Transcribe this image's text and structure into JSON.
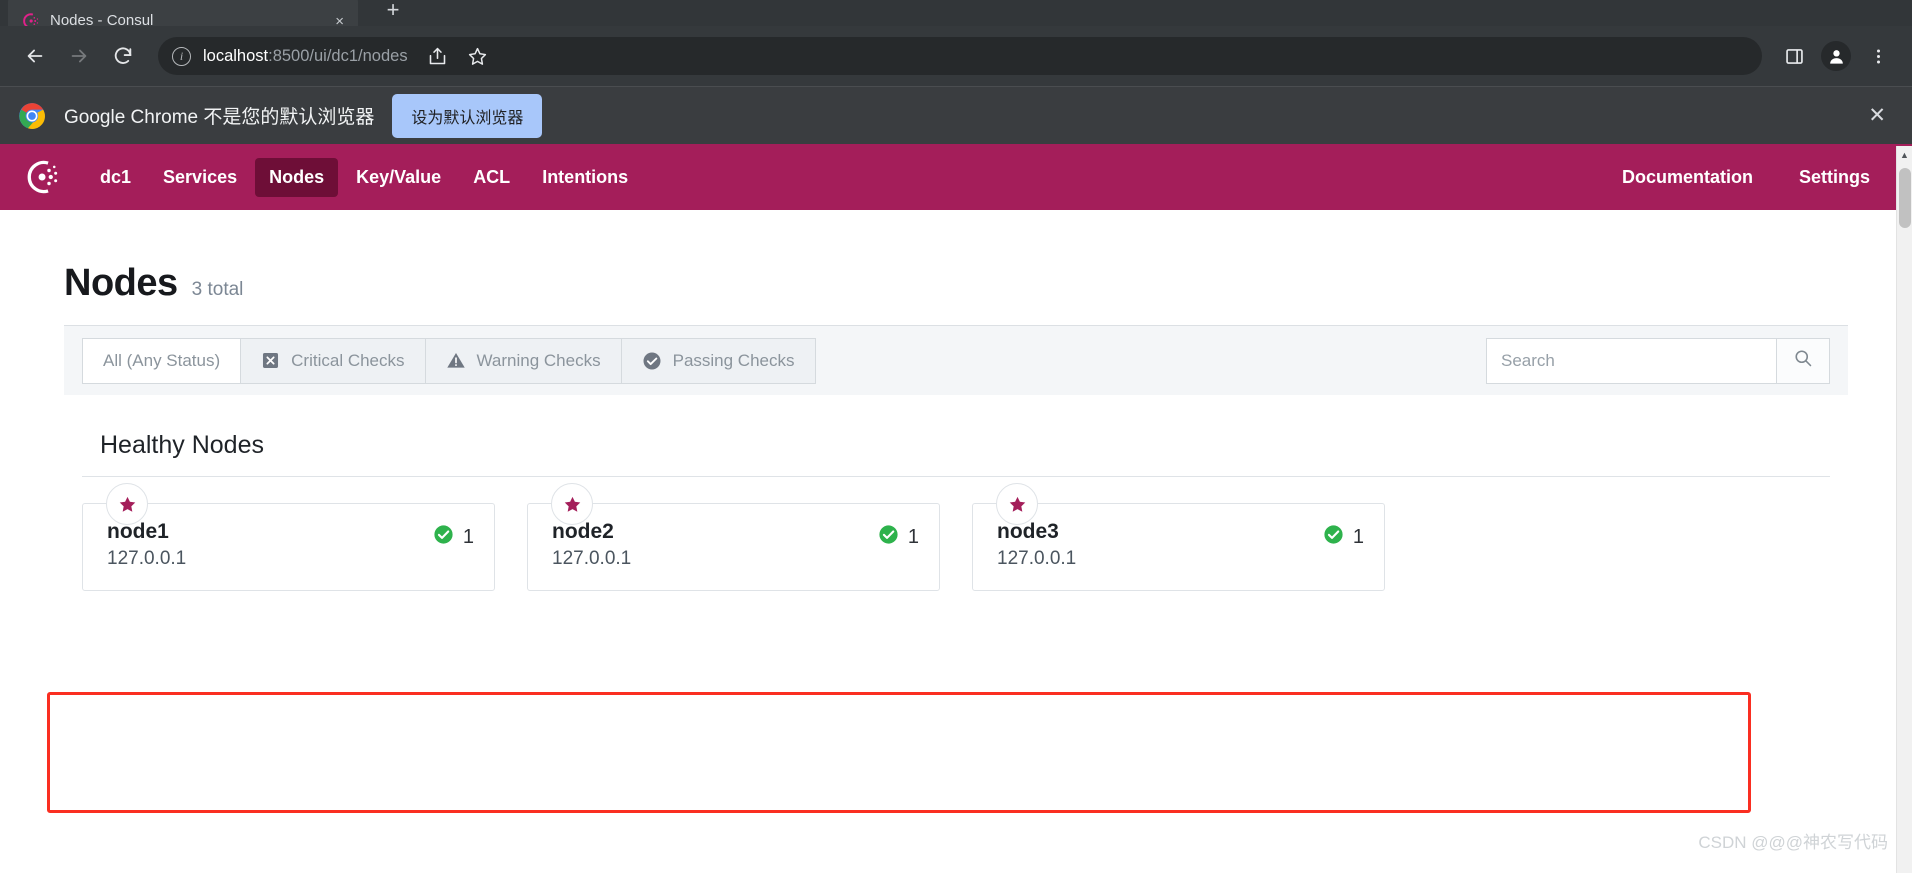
{
  "browser": {
    "tab": {
      "title": "Nodes - Consul",
      "favicon": "consul-favicon",
      "close_label": "×"
    },
    "new_tab_label": "+",
    "back_label": "←",
    "forward_label": "→",
    "reload_label": "⟳",
    "omnibox": {
      "info_label": "i",
      "url_host": "localhost",
      "url_path": ":8500/ui/dc1/nodes",
      "share_icon": "share-icon",
      "bookmark_icon": "star-icon",
      "sidepanel_icon": "side-panel-icon",
      "profile_icon": "profile-avatar-icon",
      "menu_icon": "three-dot-menu-icon"
    }
  },
  "infobar": {
    "message": "Google Chrome 不是您的默认浏览器",
    "button_label": "设为默认浏览器",
    "close_label": "✕"
  },
  "consul_nav": {
    "logo": "consul-logo-icon",
    "items": [
      {
        "label": "dc1",
        "active": false
      },
      {
        "label": "Services",
        "active": false
      },
      {
        "label": "Nodes",
        "active": true
      },
      {
        "label": "Key/Value",
        "active": false
      },
      {
        "label": "ACL",
        "active": false
      },
      {
        "label": "Intentions",
        "active": false
      }
    ],
    "right_items": [
      {
        "label": "Documentation"
      },
      {
        "label": "Settings"
      }
    ],
    "brand_color": "#A41E5A",
    "active_color": "#6E0E37"
  },
  "page": {
    "title": "Nodes",
    "count_label": "3 total",
    "filters": [
      {
        "label": "All (Any Status)",
        "icon": "none",
        "active": true
      },
      {
        "label": "Critical Checks",
        "icon": "critical-x-icon",
        "active": false
      },
      {
        "label": "Warning Checks",
        "icon": "warning-triangle-icon",
        "active": false
      },
      {
        "label": "Passing Checks",
        "icon": "passing-check-icon",
        "active": false
      }
    ],
    "search": {
      "value": "",
      "placeholder": "Search",
      "button_icon": "search-icon"
    }
  },
  "healthy_nodes": {
    "section_title": "Healthy Nodes",
    "highlight_color": "#fa2e21",
    "nodes": [
      {
        "name": "node1",
        "address": "127.0.0.1",
        "health_count": "1",
        "health_status": "passing"
      },
      {
        "name": "node2",
        "address": "127.0.0.1",
        "health_count": "1",
        "health_status": "passing"
      },
      {
        "name": "node3",
        "address": "127.0.0.1",
        "health_count": "1",
        "health_status": "passing"
      }
    ],
    "status_color": "#2EB24C",
    "star_color": "#A41E5A"
  },
  "scrollbar": {
    "up_label": "▲"
  },
  "watermark": "CSDN @@@神农写代码"
}
